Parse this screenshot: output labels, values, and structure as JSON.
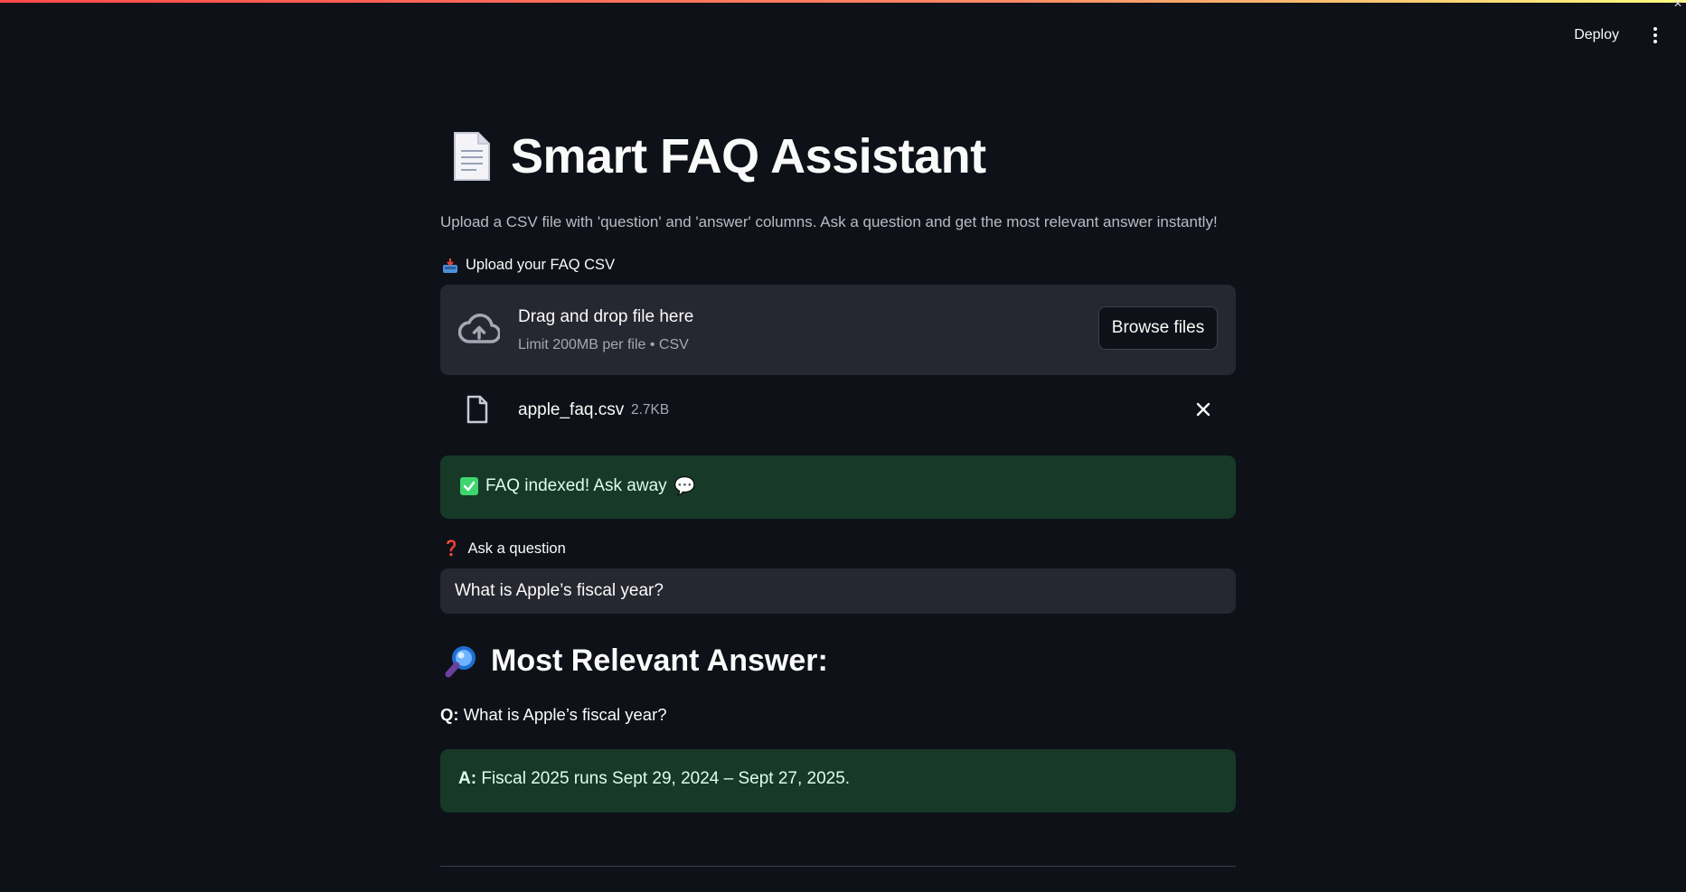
{
  "header": {
    "deploy_label": "Deploy"
  },
  "app": {
    "title": "Smart FAQ Assistant",
    "subtitle": "Upload a CSV file with 'question' and 'answer' columns. Ask a question and get the most relevant answer instantly!"
  },
  "upload": {
    "label": "Upload your FAQ CSV",
    "dropzone_title": "Drag and drop file here",
    "dropzone_limit": "Limit 200MB per file • CSV",
    "browse_label": "Browse files",
    "file_name": "apple_faq.csv",
    "file_size": "2.7KB"
  },
  "status": {
    "success_text": "FAQ indexed! Ask away",
    "success_emoji": "💬"
  },
  "question": {
    "label": "Ask a question",
    "label_emoji": "❓",
    "value": "What is Apple’s fiscal year?"
  },
  "answer": {
    "heading": "Most Relevant Answer:",
    "q_prefix": "Q:",
    "q_text": "What is Apple’s fiscal year?",
    "a_prefix": "A:",
    "a_text": "Fiscal 2025 runs Sept 29, 2024 – Sept 27, 2025."
  },
  "colors": {
    "background": "#0e1117",
    "panel": "#262730",
    "success_bg": "#173928",
    "success_text": "#dffde9",
    "check_green": "#3dd56d"
  },
  "icons": {
    "title_icon": "document-icon",
    "upload_label_icon": "inbox-tray-icon",
    "dropzone_icon": "cloud-upload-icon",
    "file_icon": "file-icon",
    "remove_icon": "close-icon",
    "success_icon": "check-mark-icon",
    "heading_icon": "magnifier-icon"
  }
}
